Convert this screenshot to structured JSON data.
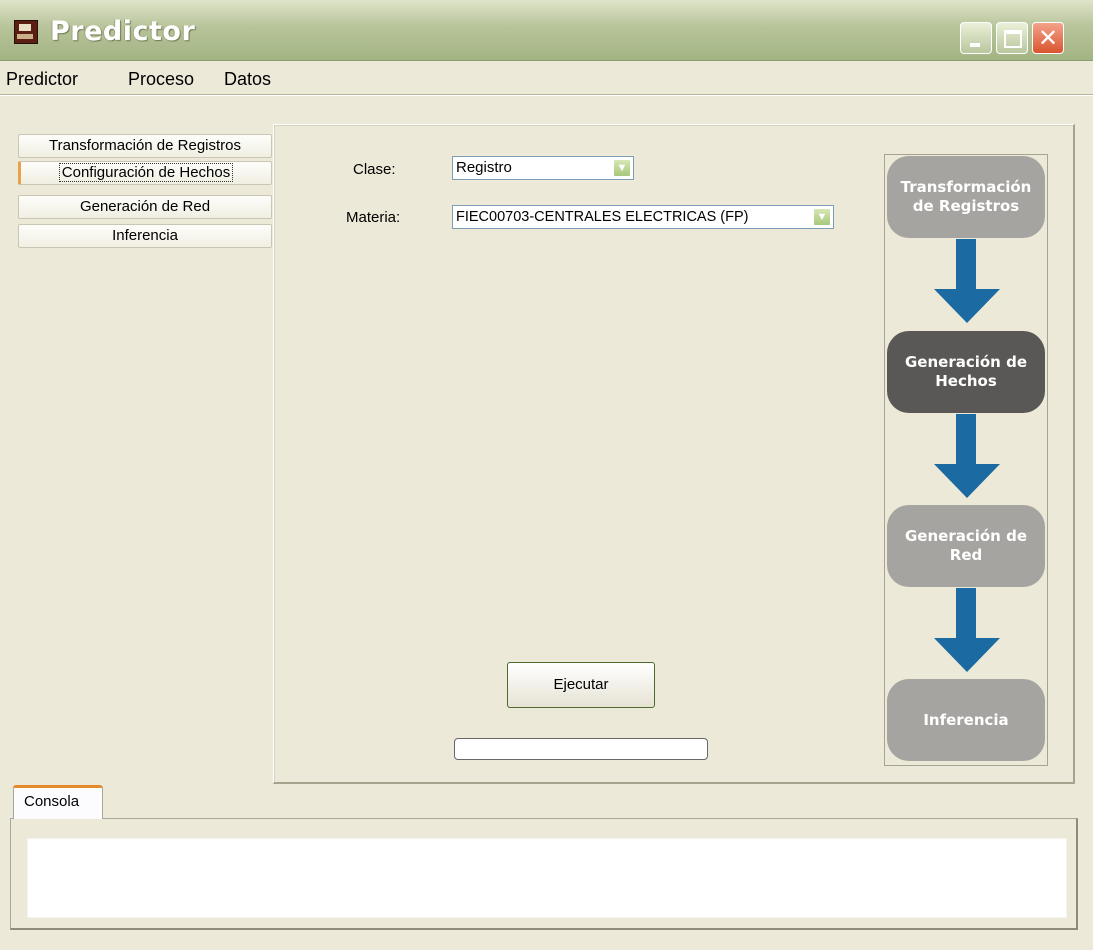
{
  "window": {
    "title": "Predictor",
    "close_glyph": "✕"
  },
  "menu": [
    "Predictor",
    "Proceso",
    "Datos"
  ],
  "nav": [
    {
      "label": "Transformación de Registros",
      "selected": false
    },
    {
      "label": "Configuración de Hechos",
      "selected": true
    },
    {
      "label": "Generación de Red",
      "selected": false
    },
    {
      "label": "Inferencia",
      "selected": false
    }
  ],
  "form": {
    "clase_label": "Clase:",
    "clase_value": "Registro",
    "materia_label": "Materia:",
    "materia_value": "FIEC00703-CENTRALES ELECTRICAS (FP)"
  },
  "execute_label": "Ejecutar",
  "progress": 0,
  "flow": [
    {
      "label": "Transformación de Registros",
      "active": false
    },
    {
      "label": "Generación de Hechos",
      "active": true
    },
    {
      "label": "Generación de Red",
      "active": false
    },
    {
      "label": "Inferencia",
      "active": false
    }
  ],
  "console_tab": "Consola",
  "colors": {
    "titlebar": "#b7c49a",
    "accent_orange": "#e9a24a",
    "flow_active": "#5a5856",
    "flow_inactive": "#a6a4a0",
    "flow_arrow": "#1b6aa1"
  },
  "icons": [
    "app-icon",
    "minimize-icon",
    "maximize-icon",
    "close-icon",
    "chevron-down-icon",
    "arrow-down-icon"
  ]
}
